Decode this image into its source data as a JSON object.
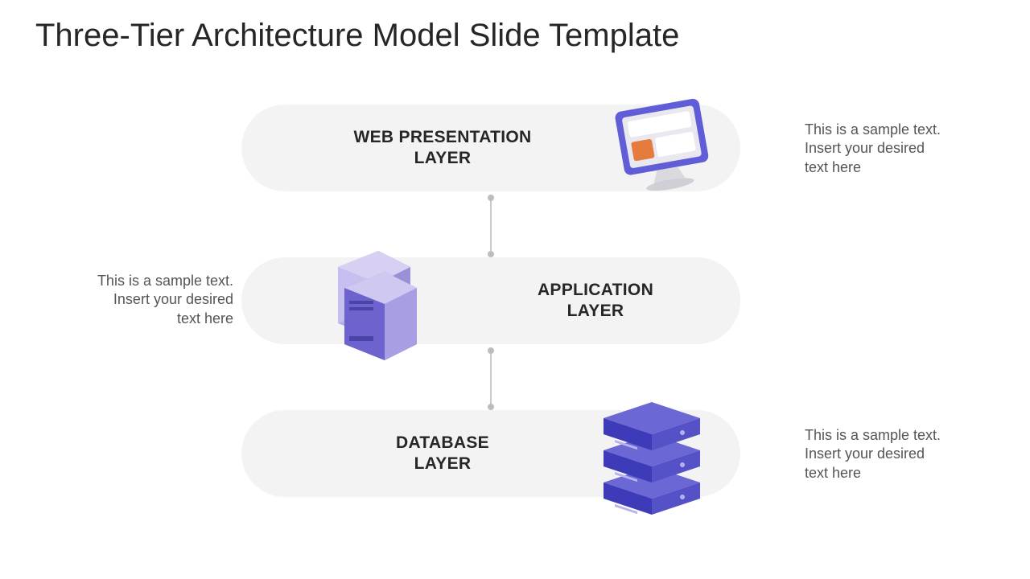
{
  "title": "Three-Tier Architecture Model Slide Template",
  "tiers": [
    {
      "label_l1": "WEB PRESENTATION",
      "label_l2": "LAYER",
      "desc_l1": "This is a sample text.",
      "desc_l2": "Insert your desired",
      "desc_l3": "text here",
      "icon": "monitor-icon"
    },
    {
      "label_l1": "APPLICATION",
      "label_l2": "LAYER",
      "desc_l1": "This is a sample text.",
      "desc_l2": "Insert your desired",
      "desc_l3": "text here",
      "icon": "server-icon"
    },
    {
      "label_l1": "DATABASE",
      "label_l2": "LAYER",
      "desc_l1": "This is a sample text.",
      "desc_l2": "Insert your desired",
      "desc_l3": "text here",
      "icon": "database-icon"
    }
  ],
  "colors": {
    "accent": "#5f5ed7",
    "accent_light": "#a8a1e0",
    "accent_dark": "#3d3bb8",
    "orange": "#e57b3d"
  }
}
